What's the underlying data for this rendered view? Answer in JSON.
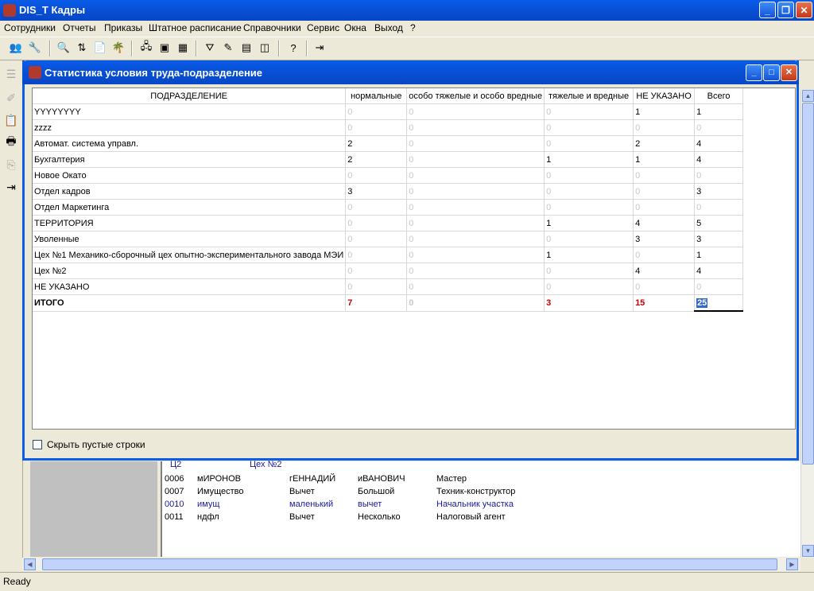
{
  "app": {
    "title": "DIS_T Кадры"
  },
  "menu": [
    "Сотрудники",
    "Отчеты",
    "Приказы",
    "Штатное расписание",
    "Справочники",
    "Сервис",
    "Окна",
    "Выход",
    "?"
  ],
  "dialog": {
    "title": "Статистика условия труда-подразделение",
    "columns": [
      "ПОДРАЗДЕЛЕНИЕ",
      "нормальные",
      "особо тяжелые и особо вредные",
      "тяжелые и вредные",
      "НЕ УКАЗАНО",
      "Всего"
    ],
    "rows": [
      [
        "YYYYYYYY",
        "0",
        "0",
        "0",
        "1",
        "1"
      ],
      [
        "zzzz",
        "0",
        "0",
        "0",
        "0",
        "0"
      ],
      [
        "Автомат. система управл.",
        "2",
        "0",
        "0",
        "2",
        "4"
      ],
      [
        "Бухгалтерия",
        "2",
        "0",
        "1",
        "1",
        "4"
      ],
      [
        "Новое Окато",
        "0",
        "0",
        "0",
        "0",
        "0"
      ],
      [
        "Отдел кадров",
        "3",
        "0",
        "0",
        "0",
        "3"
      ],
      [
        "Отдел Маркетинга",
        "0",
        "0",
        "0",
        "0",
        "0"
      ],
      [
        "ТЕРРИТОРИЯ",
        "0",
        "0",
        "1",
        "4",
        "5"
      ],
      [
        "Уволенные",
        "0",
        "0",
        "0",
        "3",
        "3"
      ],
      [
        "Цех №1 Механико-сборочный цех опытно-экспериментального завода МЭИ",
        "0",
        "0",
        "1",
        "0",
        "1"
      ],
      [
        "Цех №2",
        "0",
        "0",
        "0",
        "4",
        "4"
      ],
      [
        "НЕ УКАЗАНО",
        "0",
        "0",
        "0",
        "0",
        "0"
      ]
    ],
    "total": [
      "ИТОГО",
      "7",
      "0",
      "3",
      "15",
      "25"
    ],
    "hide_empty_label": "Скрыть пустые строки",
    "hide_empty_checked": false
  },
  "background_list": {
    "header": [
      "Ц2",
      "Цех №2"
    ],
    "rows": [
      [
        "0006",
        "мИРОНОВ",
        "гЕННАДИЙ",
        "иВАНОВИЧ",
        "Мастер"
      ],
      [
        "0007",
        "Имущество",
        "Вычет",
        "Большой",
        "Техник-конструктор"
      ],
      [
        "0010",
        "имущ",
        "маленький",
        "вычет",
        "Начальник участка"
      ],
      [
        "0011",
        "ндфл",
        "Вычет",
        "Несколько",
        "Налоговый агент"
      ]
    ]
  },
  "status": {
    "text": "Ready"
  },
  "colors": {
    "titlebar": "#0a5ce9",
    "accent_blue": "#1a1aa0",
    "total_red": "#cc0000"
  }
}
